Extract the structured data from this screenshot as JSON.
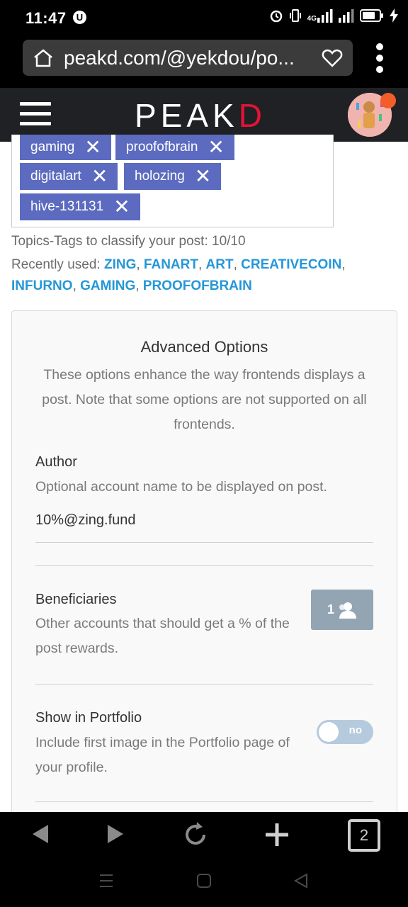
{
  "status_bar": {
    "time": "11:47",
    "u_badge": "U",
    "network": "4G"
  },
  "browser": {
    "url": "peakd.com/@yekdou/po..."
  },
  "header": {
    "logo_main": "PEAK",
    "logo_accent": "D"
  },
  "tags": [
    {
      "label": "gaming"
    },
    {
      "label": "proofofbrain"
    },
    {
      "label": "digitalart"
    },
    {
      "label": "holozing"
    },
    {
      "label": "hive-131131"
    }
  ],
  "tags_hint": "Topics-Tags to classify your post: 10/10",
  "recently_used": {
    "label": "Recently used:",
    "items": [
      "ZING",
      "FANART",
      "ART",
      "CREATIVECOIN",
      "INFURNO",
      "GAMING",
      "PROOFOFBRAIN"
    ]
  },
  "advanced": {
    "title": "Advanced Options",
    "description": "These options enhance the way frontends displays a post. Note that some options are not supported on all frontends.",
    "author": {
      "label": "Author",
      "description": "Optional account name to be displayed on post.",
      "value": "10%@zing.fund"
    },
    "beneficiaries": {
      "label": "Beneficiaries",
      "description": "Other accounts that should get a % of the post rewards.",
      "count": "1"
    },
    "portfolio": {
      "label": "Show in Portfolio",
      "description": "Include first image in the Portfolio page of your profile.",
      "toggle_label": "no"
    }
  },
  "bottom_nav": {
    "tab_count": "2"
  },
  "colors": {
    "tag_bg": "#5c6bc0",
    "link": "#2597d8",
    "logo_accent": "#e31337",
    "header_bg": "#202124"
  }
}
